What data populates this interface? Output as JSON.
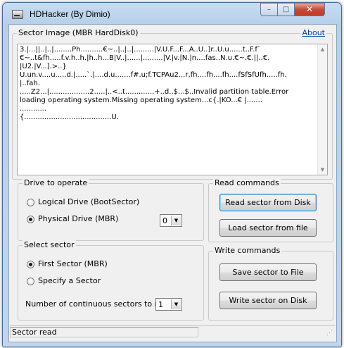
{
  "window": {
    "title": "HDHacker (By Dimio)",
    "controls": {
      "minimize": "–",
      "maximize": "□",
      "close": "✕"
    }
  },
  "sector_image": {
    "legend": "Sector Image (MBR HardDisk0)",
    "about_link": "About",
    "content": "3.|...||..|..|........Ph..........€~..|..|..|.........|V.U.F...F...A..U..]r..U.u......t..F.f`\n€~..t&fh.....f.v.h..h.|h..h...B|V..|......|.........|V.|v.|N.|n....fas..N.u.€~.€.||..€.\n|U2.|V...].>..}\nU.un.v....u.....d.|.....`.|....d.u.......f#.u;f.TCPAu2...r,fh....fh....fh....fSfSfUfh.....fh.|..fah.\n.....Z2...|..................2.....|..<..t.............+..d..$...$..Invalid partition table.Error loading operating system.Missing operating system...c{.|KO...€ |.......  ............\n{.......................................U."
  },
  "drive": {
    "legend": "Drive to operate",
    "options": [
      {
        "label": "Logical Drive (BootSector)",
        "checked": false
      },
      {
        "label": "Physical Drive (MBR)",
        "checked": true
      }
    ],
    "drive_select_value": "0",
    "dropdown_arrow": "▼"
  },
  "sector": {
    "legend": "Select sector",
    "options": [
      {
        "label": "First Sector (MBR)",
        "checked": true
      },
      {
        "label": "Specify a Sector",
        "checked": false
      }
    ],
    "continuous_label": "Number of continuous sectors to read",
    "continuous_value": "1",
    "dropdown_arrow": "▼"
  },
  "read_commands": {
    "legend": "Read commands",
    "read_button": "Read sector from Disk",
    "load_button": "Load sector from file"
  },
  "write_commands": {
    "legend": "Write commands",
    "save_button": "Save sector to File",
    "write_button": "Write sector on Disk"
  },
  "scrollbar": {
    "up": "▲",
    "down": "▼"
  },
  "statusbar": {
    "text": "Sector read",
    "grip": "⋰"
  }
}
